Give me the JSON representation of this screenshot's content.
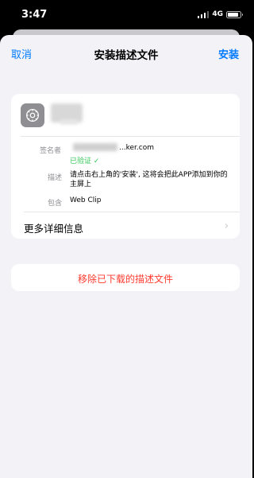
{
  "status_bar": {
    "time": "3:47",
    "network": "4G"
  },
  "nav": {
    "cancel_label": "取消",
    "title": "安装描述文件",
    "install_label": "安装"
  },
  "profile": {
    "icon": "settings-gear-icon",
    "details": [
      {
        "label": "签名者",
        "value": "...ker.com",
        "status": "已验证",
        "status_icon": "checkmark-icon"
      },
      {
        "label": "描述",
        "value": "请点击右上角的'安装', 这将会把此APP添加到你的主屏上"
      },
      {
        "label": "包含",
        "value": "Web Clip"
      }
    ],
    "more_details_label": "更多详细信息"
  },
  "remove_label": "移除已下载的描述文件",
  "colors": {
    "accent": "#007aff",
    "destructive": "#ff3b30",
    "verified": "#34c759",
    "background": "#f2f2f7"
  }
}
